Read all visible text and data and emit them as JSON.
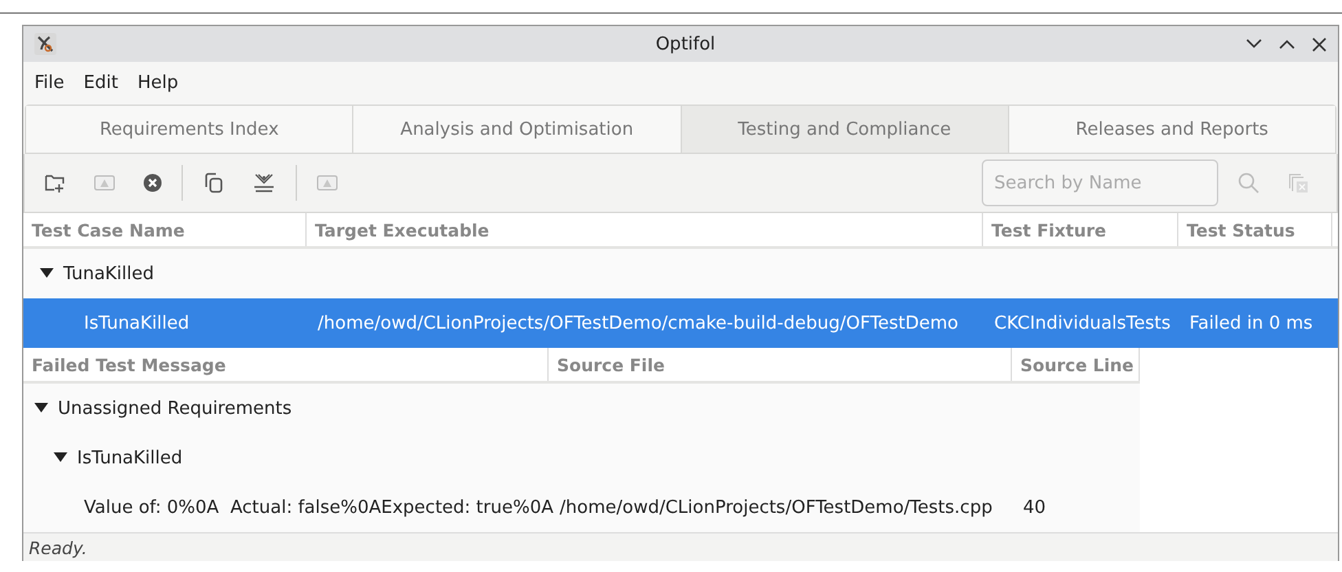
{
  "window": {
    "title": "Optifol"
  },
  "menu": [
    "File",
    "Edit",
    "Help"
  ],
  "tabs": [
    {
      "label": "Requirements Index",
      "selected": false
    },
    {
      "label": "Analysis and Optimisation",
      "selected": false
    },
    {
      "label": "Testing and Compliance",
      "selected": true
    },
    {
      "label": "Releases and Reports",
      "selected": false
    }
  ],
  "toolbar": [
    {
      "kind": "folder-add",
      "disabled": false
    },
    {
      "kind": "image",
      "disabled": true
    },
    {
      "kind": "remove",
      "disabled": false
    },
    {
      "kind": "separator"
    },
    {
      "kind": "copy",
      "disabled": false
    },
    {
      "kind": "tray",
      "disabled": false
    },
    {
      "kind": "separator"
    },
    {
      "kind": "image",
      "disabled": true
    }
  ],
  "search": {
    "placeholder": "Search by Name"
  },
  "tests_table": {
    "columns": [
      "Test Case Name",
      "Target Executable",
      "Test Fixture",
      "Test Status"
    ],
    "rows": [
      {
        "label": "TunaKilled",
        "expanded": true,
        "children": [
          {
            "cells": [
              "IsTunaKilled",
              "/home/owd/CLionProjects/OFTestDemo/cmake-build-debug/OFTestDemo",
              "CKCIndividualsTests",
              "Failed in 0 ms"
            ],
            "selected": true
          }
        ]
      }
    ]
  },
  "failures_table": {
    "columns": [
      "Failed Test Message",
      "Source File",
      "Source Line"
    ],
    "rows": [
      {
        "label": "Unassigned Requirements",
        "expanded": true,
        "children": [
          {
            "label": "IsTunaKilled",
            "expanded": true,
            "children": [
              {
                "cells": [
                  "Value of: 0%0A  Actual: false%0AExpected: true%0A",
                  "/home/owd/CLionProjects/OFTestDemo/Tests.cpp",
                  "40"
                ]
              }
            ]
          }
        ]
      }
    ]
  },
  "status_bar": "Ready."
}
